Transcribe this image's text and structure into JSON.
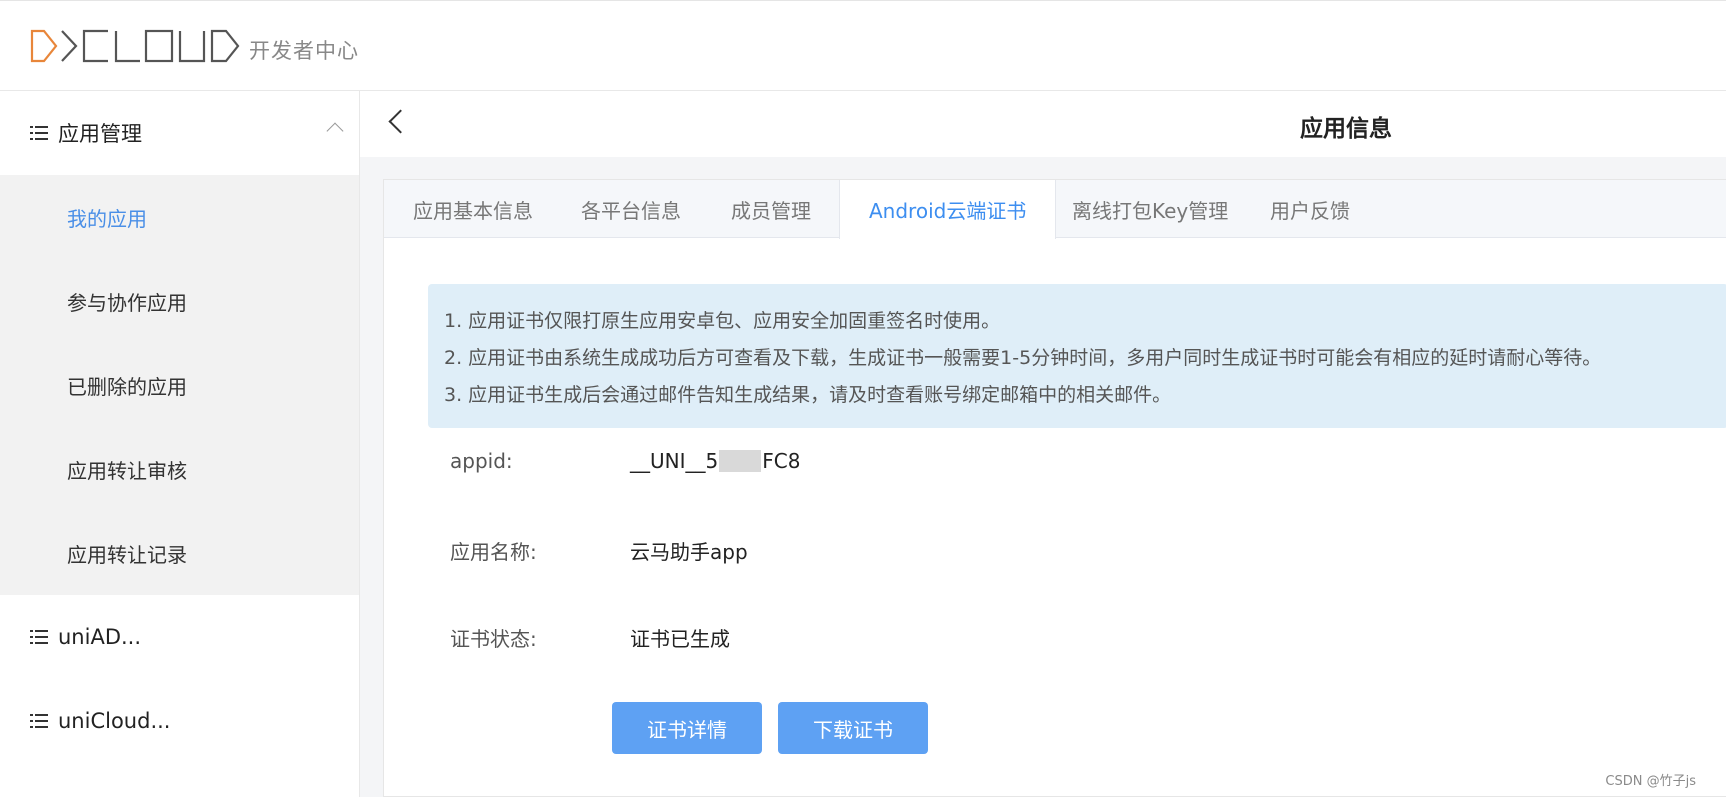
{
  "header": {
    "logo_text": "开发者中心",
    "logo_alt": "DCLOUD"
  },
  "sidebar": {
    "groups": [
      {
        "label": "应用管理",
        "expanded": true,
        "icon": "list-icon"
      },
      {
        "label": "uniAD...",
        "icon": "list-icon"
      },
      {
        "label": "uniCloud...",
        "icon": "list-icon"
      }
    ],
    "submenu": [
      {
        "label": "我的应用",
        "active": true
      },
      {
        "label": "参与协作应用"
      },
      {
        "label": "已删除的应用"
      },
      {
        "label": "应用转让审核"
      },
      {
        "label": "应用转让记录"
      }
    ]
  },
  "page": {
    "title": "应用信息",
    "back_icon": "chevron-left-icon"
  },
  "tabs": [
    {
      "label": "应用基本信息"
    },
    {
      "label": "各平台信息"
    },
    {
      "label": "成员管理"
    },
    {
      "label": "Android云端证书",
      "active": true
    },
    {
      "label": "离线打包Key管理"
    },
    {
      "label": "用户反馈"
    }
  ],
  "notice": [
    "1. 应用证书仅限打原生应用安卓包、应用安全加固重签名时使用。",
    "2. 应用证书由系统生成成功后方可查看及下载，生成证书一般需要1-5分钟时间，多用户同时生成证书时可能会有相应的延时请耐心等待。",
    "3. 应用证书生成后会通过邮件告知生成结果，请及时查看账号绑定邮箱中的相关邮件。"
  ],
  "fields": {
    "appid_label": "appid:",
    "appid_prefix": "__UNI__5",
    "appid_suffix": "FC8",
    "name_label": "应用名称:",
    "name_value": "云马助手app",
    "status_label": "证书状态:",
    "status_value": "证书已生成"
  },
  "buttons": {
    "detail": "证书详情",
    "download": "下载证书"
  },
  "watermark": "CSDN @竹子js",
  "colors": {
    "accent": "#3d8ef0",
    "button": "#5ea1f3",
    "notice_bg": "#dfeef8",
    "logo_orange": "#e8863a"
  }
}
